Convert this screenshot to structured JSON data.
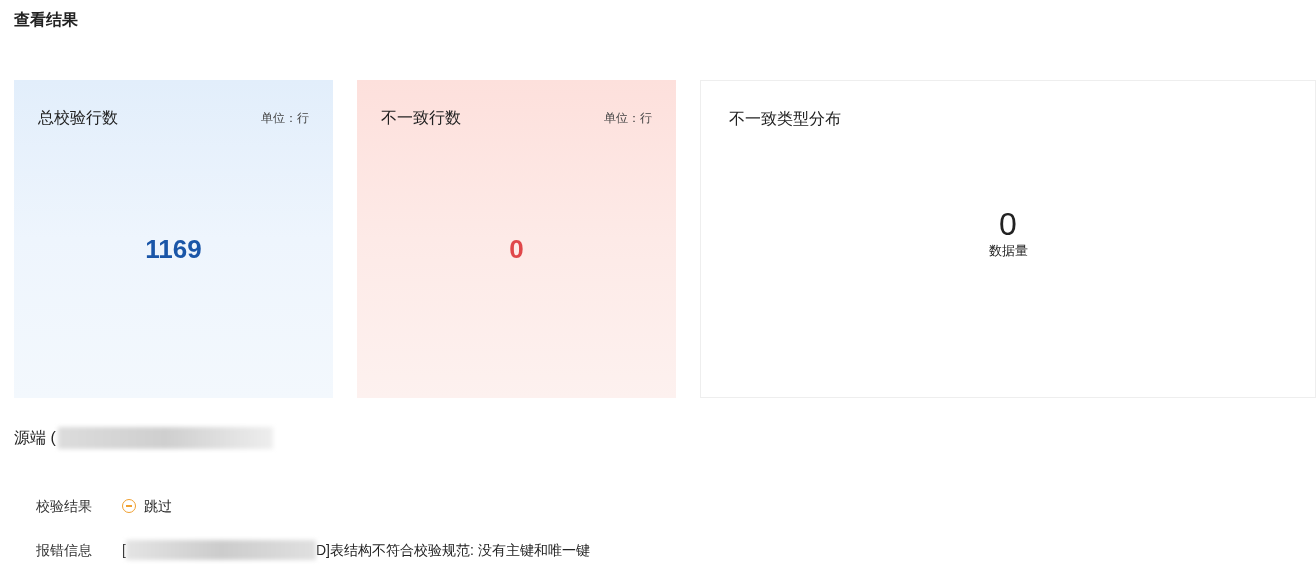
{
  "page_title": "查看结果",
  "stat_cards": [
    {
      "kind": "total",
      "title": "总校验行数",
      "unit": "单位：行",
      "value": "1169"
    },
    {
      "kind": "mismatch",
      "title": "不一致行数",
      "unit": "单位：行",
      "value": "0"
    }
  ],
  "distribution_card": {
    "title": "不一致类型分布",
    "value": "0",
    "caption": "数据量"
  },
  "source": {
    "label": "源端 (",
    "redacted": true
  },
  "details": [
    {
      "kind": "status",
      "label": "校验结果",
      "value": "跳过"
    },
    {
      "kind": "error",
      "label": "报错信息",
      "prefix": "[",
      "redacted": true,
      "value": "D]表结构不符合校验规范: 没有主键和唯一键"
    }
  ]
}
